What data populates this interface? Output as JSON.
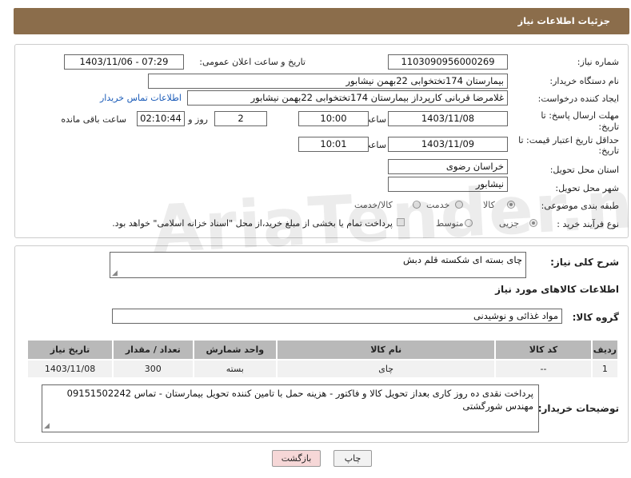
{
  "header": {
    "title": "جزئیات اطلاعات نیاز"
  },
  "form": {
    "need_number": {
      "label": "شماره نیاز:",
      "value": "1103090956000269"
    },
    "announce_datetime": {
      "label": "تاریخ و ساعت اعلان عمومی:",
      "value": "1403/11/06 - 07:29"
    },
    "buyer_org": {
      "label": "نام دستگاه خریدار:",
      "value": "بیمارستان 174تختخوابی 22بهمن نیشابور"
    },
    "requester": {
      "label": "ایجاد کننده درخواست:",
      "value": "غلامرضا قربانی کارپرداز بیمارستان 174تختخوابی 22بهمن نیشابور",
      "link": "اطلاعات تماس خریدار"
    },
    "deadline": {
      "label_line1": "مهلت ارسال پاسخ: تا",
      "label_line2": "تاریخ:",
      "date": "1403/11/08",
      "time_label": "ساعت",
      "time": "10:00",
      "days": "2",
      "days_label": "روز و",
      "remaining": "02:10:44",
      "remaining_label": "ساعت باقی مانده"
    },
    "price_validity": {
      "label_line1": "حداقل تاریخ اعتبار قیمت: تا",
      "label_line2": "تاریخ:",
      "date": "1403/11/09",
      "time_label": "ساعت",
      "time": "10:01"
    },
    "province": {
      "label": "استان محل تحویل:",
      "value": "خراسان رضوی"
    },
    "city": {
      "label": "شهر محل تحویل:",
      "value": "نیشابور"
    },
    "category": {
      "label": "طبقه بندی موضوعی:",
      "options": [
        "کالا",
        "خدمت",
        "کالا/خدمت"
      ],
      "selected": "کالا"
    },
    "purchase_type": {
      "label": "نوع فرآیند خرید :",
      "options": [
        "جزیی",
        "متوسط"
      ],
      "selected": "جزیی",
      "checkbox_text": "پرداخت تمام یا بخشی از مبلغ خرید،از محل \"اسناد خزانه اسلامی\" خواهد بود."
    }
  },
  "section2": {
    "summary_label": "شرح کلی نیاز:",
    "summary_value": "چای بسته ای شکسته قلم دبش",
    "goods_title": "اطلاعات کالاهای مورد نیاز",
    "group_label": "گروه کالا:",
    "group_value": "مواد غذائی و نوشیدنی",
    "table": {
      "headers": [
        "ردیف",
        "کد کالا",
        "نام کالا",
        "واحد شمارش",
        "تعداد / مقدار",
        "تاریخ نیاز"
      ],
      "rows": [
        [
          "1",
          "--",
          "چای",
          "بسته",
          "300",
          "1403/11/08"
        ]
      ]
    },
    "buyer_notes_label": "توضیحات خریدار:",
    "buyer_notes": "پرداخت نقدی ده روز کاری بعداز تحویل کالا و فاکتور - هزینه حمل با تامین کننده تحویل بیمارستان  - تماس 09151502242 مهندس شورگشتی"
  },
  "buttons": {
    "print": "چاپ",
    "back": "بازگشت"
  },
  "watermark": "AriaTender.neT",
  "colors": {
    "header_bg": "#8b6d4b",
    "table_header": "#b9b9b9",
    "back_button": "#f6d7d7"
  }
}
